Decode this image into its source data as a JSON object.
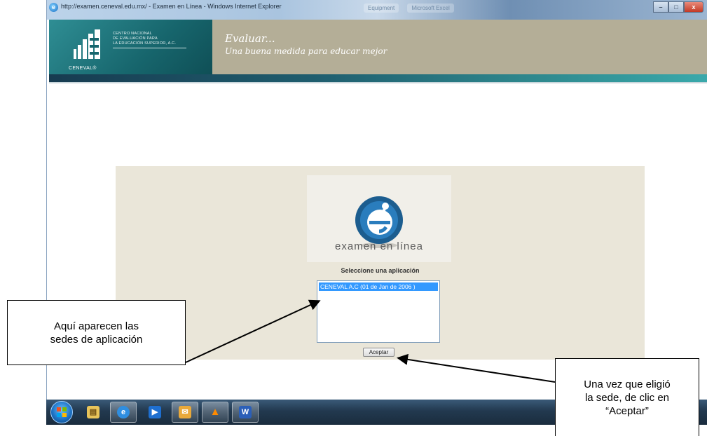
{
  "window": {
    "title": "http://examen.ceneval.edu.mx/ - Examen en Línea - Windows Internet Explorer",
    "ghost_tabs": [
      "Equipment",
      "Microsoft Excel"
    ],
    "controls": {
      "minimize": "–",
      "maximize": "□",
      "close": "x"
    }
  },
  "header": {
    "org_lines": [
      "CENTRO NACIONAL",
      "DE EVALUACIÓN PARA",
      "LA EDUCACIÓN SUPERIOR, A.C."
    ],
    "logo_name": "CENEVAL®",
    "tagline_1": "Evaluar...",
    "tagline_2": "Una buena medida para educar mejor"
  },
  "main": {
    "logo_text": "examen en línea",
    "prompt": "Seleccione una aplicación",
    "options": [
      "CENEVAL A.C (01 de Jan de 2006 )"
    ],
    "selected_index": 0,
    "accept_label": "Aceptar"
  },
  "taskbar": {
    "items": [
      "start-orb",
      "file-explorer-icon",
      "internet-explorer-icon",
      "media-player-icon",
      "outlook-icon",
      "vlc-icon",
      "word-icon"
    ],
    "active_item": "internet-explorer-icon"
  },
  "callouts": {
    "left": {
      "line1": "Aquí aparecen las",
      "line2": "sedes de aplicación"
    },
    "right": {
      "line1": "Una vez que eligió",
      "line2": "la sede, de clic en",
      "line3": "“Aceptar”"
    }
  },
  "colors": {
    "header_teal": "#17666d",
    "tagline_panel": "#b4ae97",
    "panel_bg": "#eae6d9",
    "selection_blue": "#3399ff"
  }
}
